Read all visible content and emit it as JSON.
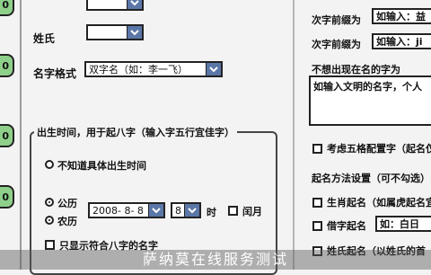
{
  "left_tabs": [
    "0",
    "0",
    "0",
    "0"
  ],
  "fields": {
    "surname_label": "姓氏",
    "name_style_label": "名字格式",
    "name_style_value": "双字名（如：李一飞）"
  },
  "birth": {
    "legend": "出生时间，用于起八字（输入字五行宜佳字）",
    "unknown_label": "不知道具体出生时间",
    "solar_label": "公历",
    "lunar_label": "农历",
    "date_value": "2008- 8- 8",
    "hour_value": "8",
    "hour_unit": "时",
    "leap_label": "闰月",
    "bazi_label": "只显示符合八字的名字"
  },
  "right": {
    "second_char_label": "次字前缀为",
    "second_char_placeholder": "如输入：益",
    "second_char_label2": "次字前缀为",
    "second_char_placeholder2": "如输入：ji",
    "exclude_label": "不想出现在名的字为",
    "exclude_placeholder": "如输入文明的名字，个人",
    "wuxing_label": "考虑五格配置字（起名仅",
    "settings_label": "起名方法设置（可不勾选）",
    "zodiac_label": "生肖起名（如属虎起名宜",
    "borrow_label": "借字起名",
    "borrow_placeholder": "如：白日",
    "surname_first_label": "姓氏起名（以姓氏的首"
  },
  "watermark": "萨纳莫在线服务测试"
}
